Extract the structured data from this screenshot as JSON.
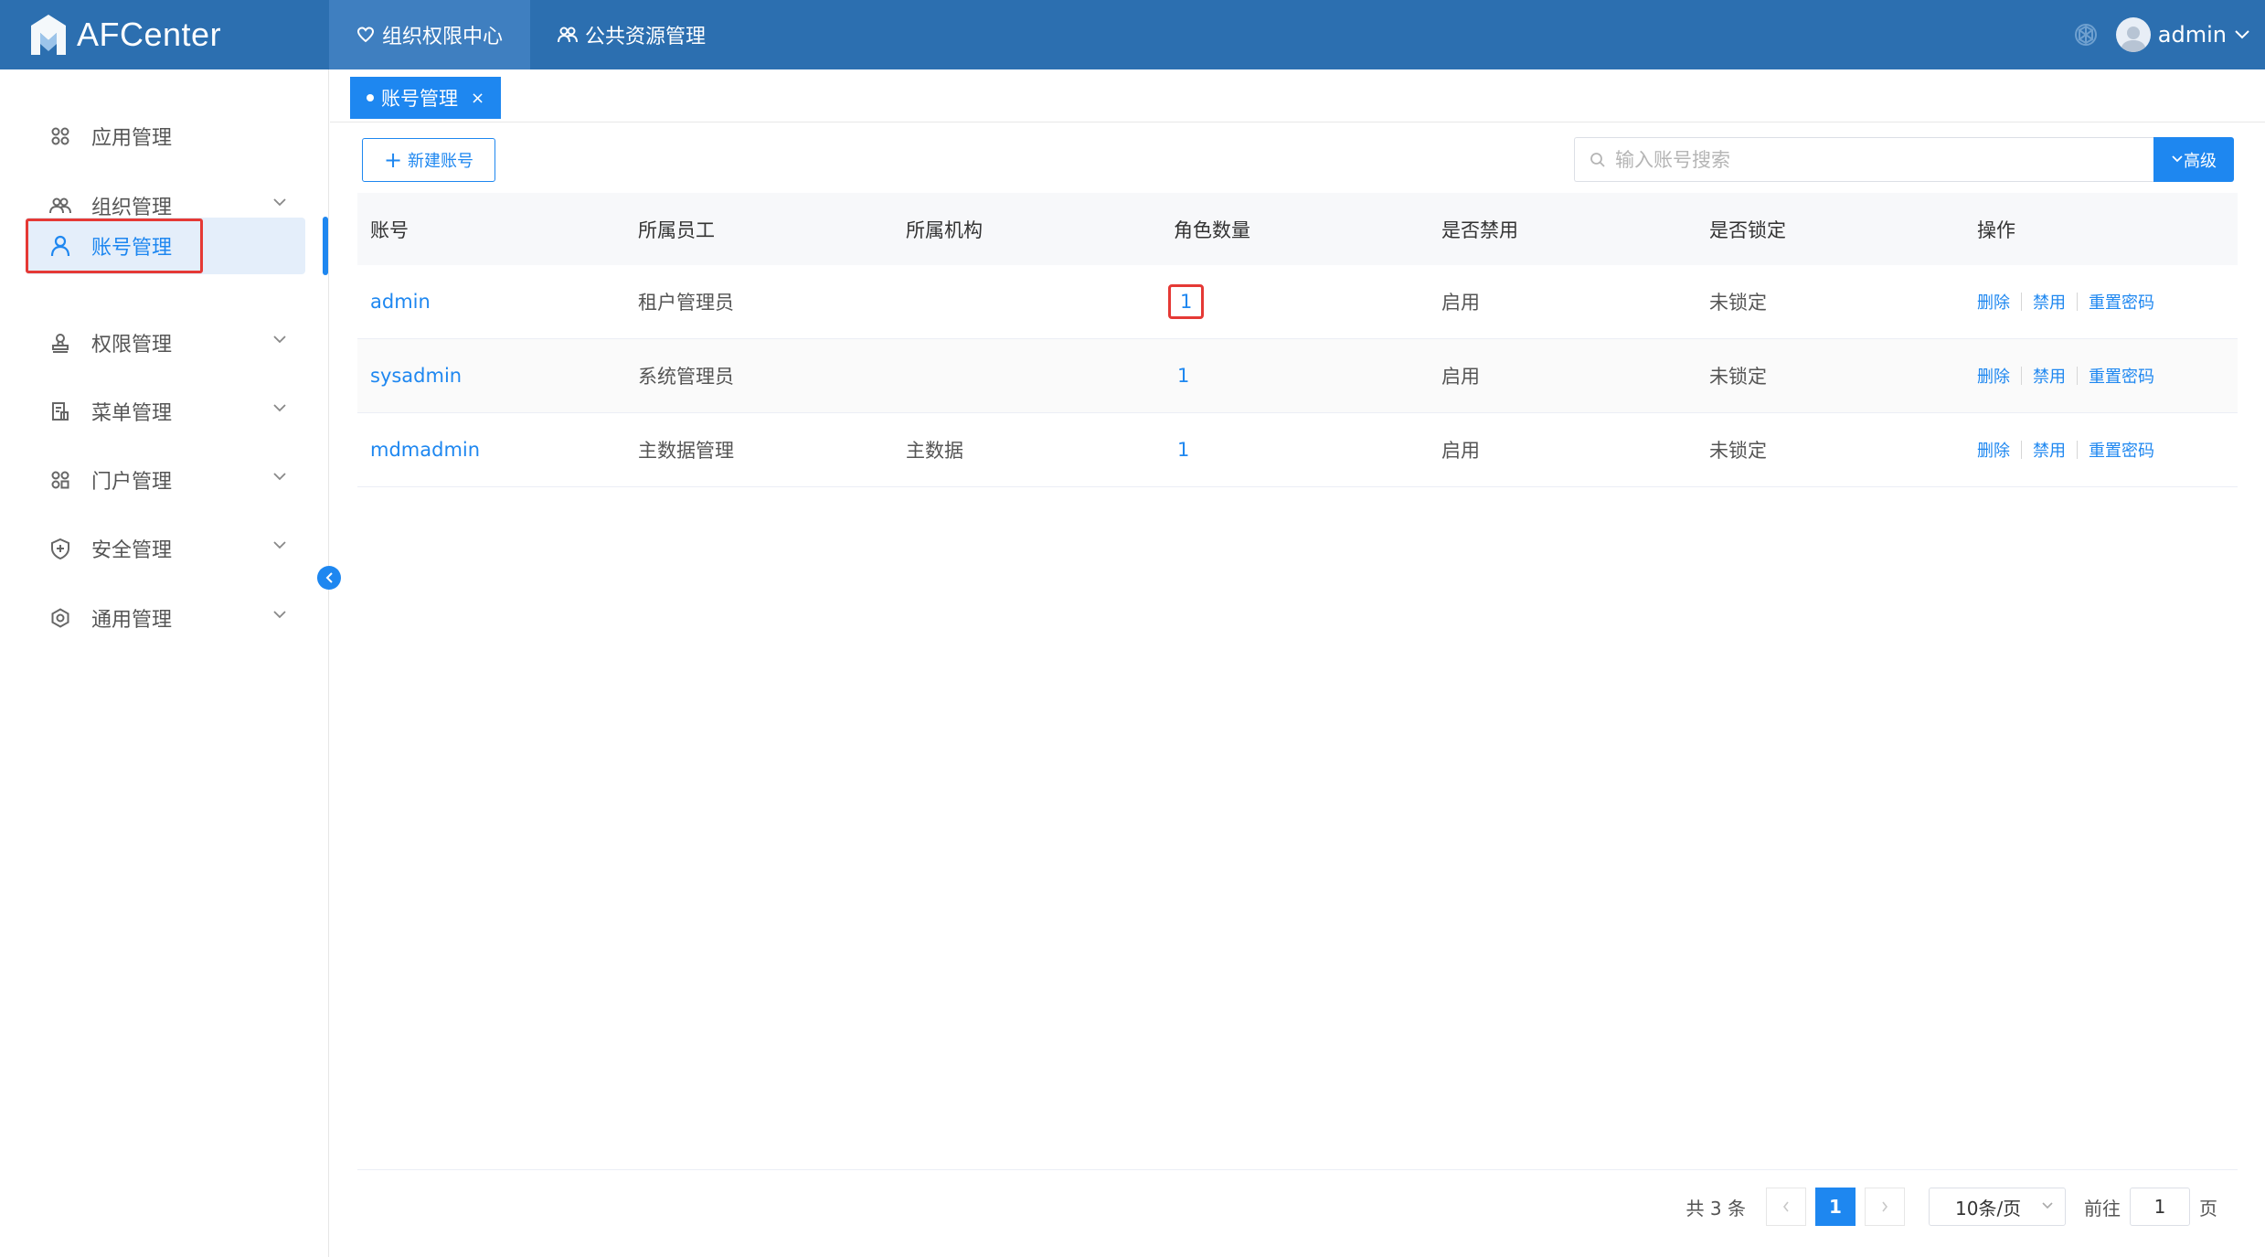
{
  "app": {
    "logo_text": "AFCenter"
  },
  "topnav": [
    {
      "label": "组织权限中心",
      "active": true
    },
    {
      "label": "公共资源管理",
      "active": false
    }
  ],
  "user": {
    "name": "admin"
  },
  "sidebar": {
    "items": [
      {
        "label": "应用管理",
        "icon": "grid-icon"
      },
      {
        "label": "组织管理",
        "icon": "group-icon"
      },
      {
        "label": "账号管理",
        "icon": "user-icon",
        "active": true
      },
      {
        "label": "权限管理",
        "icon": "stamp-icon"
      },
      {
        "label": "菜单管理",
        "icon": "menu-doc-icon"
      },
      {
        "label": "门户管理",
        "icon": "grid-icon"
      },
      {
        "label": "安全管理",
        "icon": "shield-icon"
      },
      {
        "label": "通用管理",
        "icon": "settings-icon"
      }
    ]
  },
  "tab": {
    "label": "账号管理",
    "close": "×"
  },
  "toolbar": {
    "new_label": "新建账号",
    "search_placeholder": "输入账号搜索",
    "advanced_label": "高级"
  },
  "table": {
    "columns": [
      "账号",
      "所属员工",
      "所属机构",
      "角色数量",
      "是否禁用",
      "是否锁定",
      "操作"
    ],
    "rows": [
      {
        "account": "admin",
        "employee": "租户管理员",
        "org": "",
        "roles": "1",
        "disabled": "启用",
        "locked": "未锁定"
      },
      {
        "account": "sysadmin",
        "employee": "系统管理员",
        "org": "",
        "roles": "1",
        "disabled": "启用",
        "locked": "未锁定"
      },
      {
        "account": "mdmadmin",
        "employee": "主数据管理",
        "org": "主数据",
        "roles": "1",
        "disabled": "启用",
        "locked": "未锁定"
      }
    ],
    "actions": {
      "delete": "删除",
      "disable": "禁用",
      "reset": "重置密码"
    }
  },
  "pager": {
    "total": "共 3 条",
    "current": "1",
    "size": "10条/页",
    "goto_label": "前往",
    "goto_value": "1",
    "page_suffix": "页"
  },
  "colors": {
    "header": "#2c6fb0",
    "accent": "#1e87f0",
    "highlight": "#e53935"
  }
}
